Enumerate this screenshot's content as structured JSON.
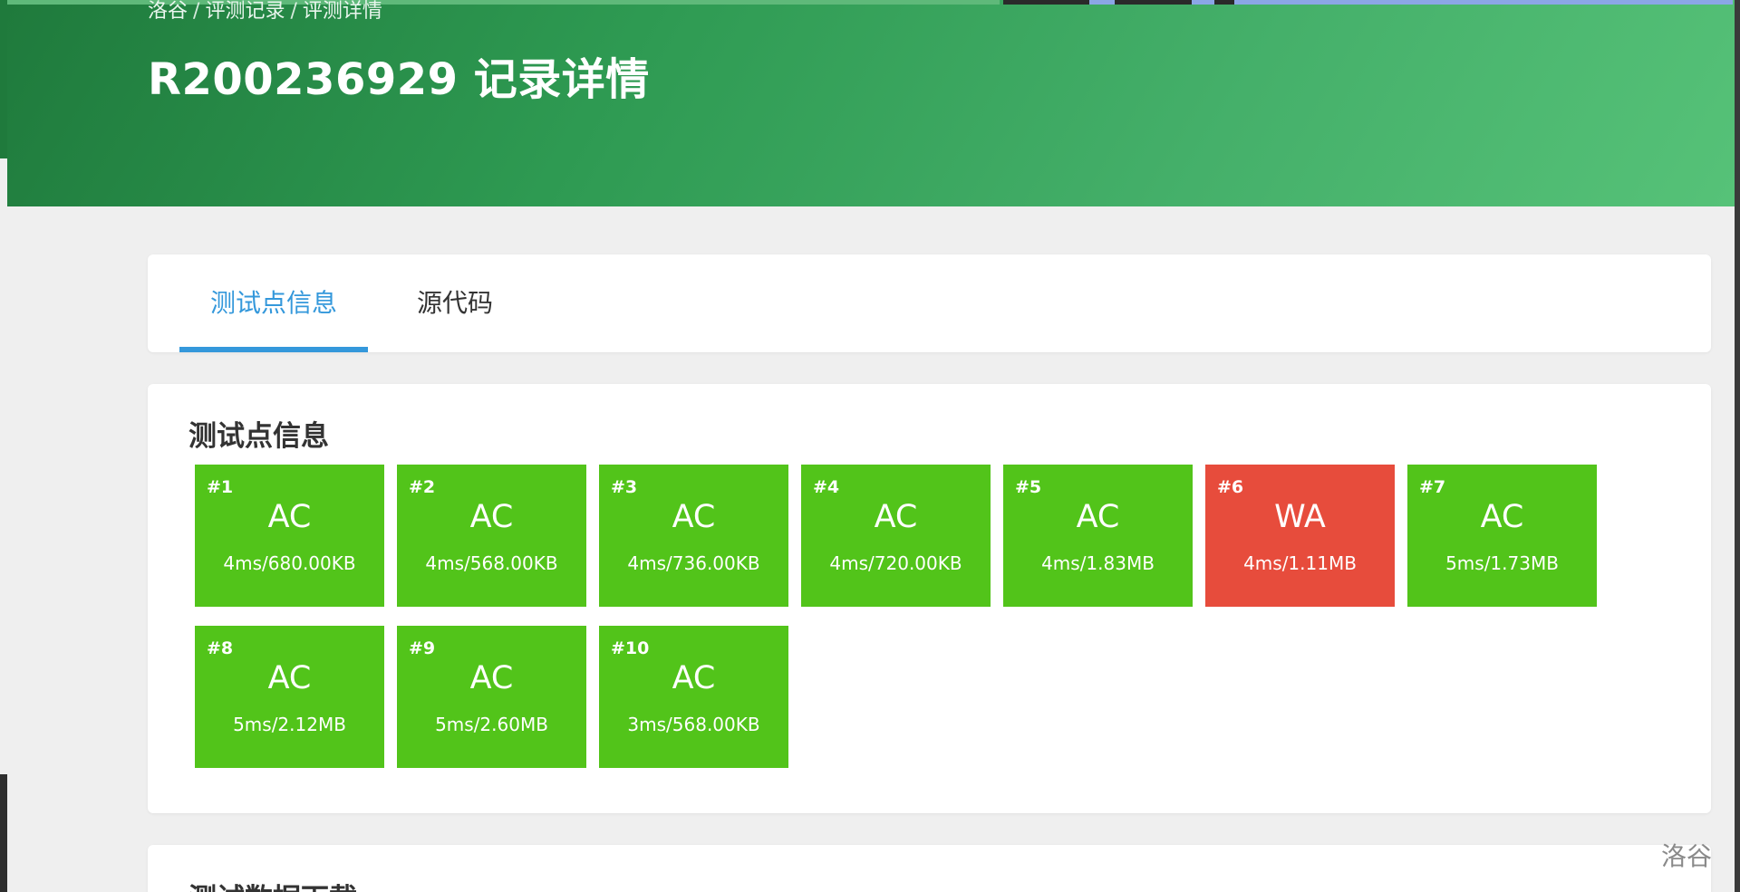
{
  "breadcrumb": [
    "洛谷",
    "评测记录",
    "评测详情"
  ],
  "breadcrumb_sep": "/",
  "title": "R200236929 记录详情",
  "tabs": [
    {
      "label": "测试点信息",
      "active": true
    },
    {
      "label": "源代码",
      "active": false
    }
  ],
  "cases_section": {
    "title": "测试点信息",
    "cases": [
      {
        "num": "#1",
        "status": "AC",
        "info": "4ms/680.00KB"
      },
      {
        "num": "#2",
        "status": "AC",
        "info": "4ms/568.00KB"
      },
      {
        "num": "#3",
        "status": "AC",
        "info": "4ms/736.00KB"
      },
      {
        "num": "#4",
        "status": "AC",
        "info": "4ms/720.00KB"
      },
      {
        "num": "#5",
        "status": "AC",
        "info": "4ms/1.83MB"
      },
      {
        "num": "#6",
        "status": "WA",
        "info": "4ms/1.11MB"
      },
      {
        "num": "#7",
        "status": "AC",
        "info": "5ms/1.73MB"
      },
      {
        "num": "#8",
        "status": "AC",
        "info": "5ms/2.12MB"
      },
      {
        "num": "#9",
        "status": "AC",
        "info": "5ms/2.60MB"
      },
      {
        "num": "#10",
        "status": "AC",
        "info": "3ms/568.00KB"
      }
    ]
  },
  "download_section": {
    "title": "测试数据下载"
  },
  "watermark": "洛谷",
  "colors": {
    "ac": "#52c41a",
    "wa": "#e74c3c",
    "accent": "#3498db",
    "header_start": "#1f7a3c",
    "header_end": "#56c278"
  }
}
